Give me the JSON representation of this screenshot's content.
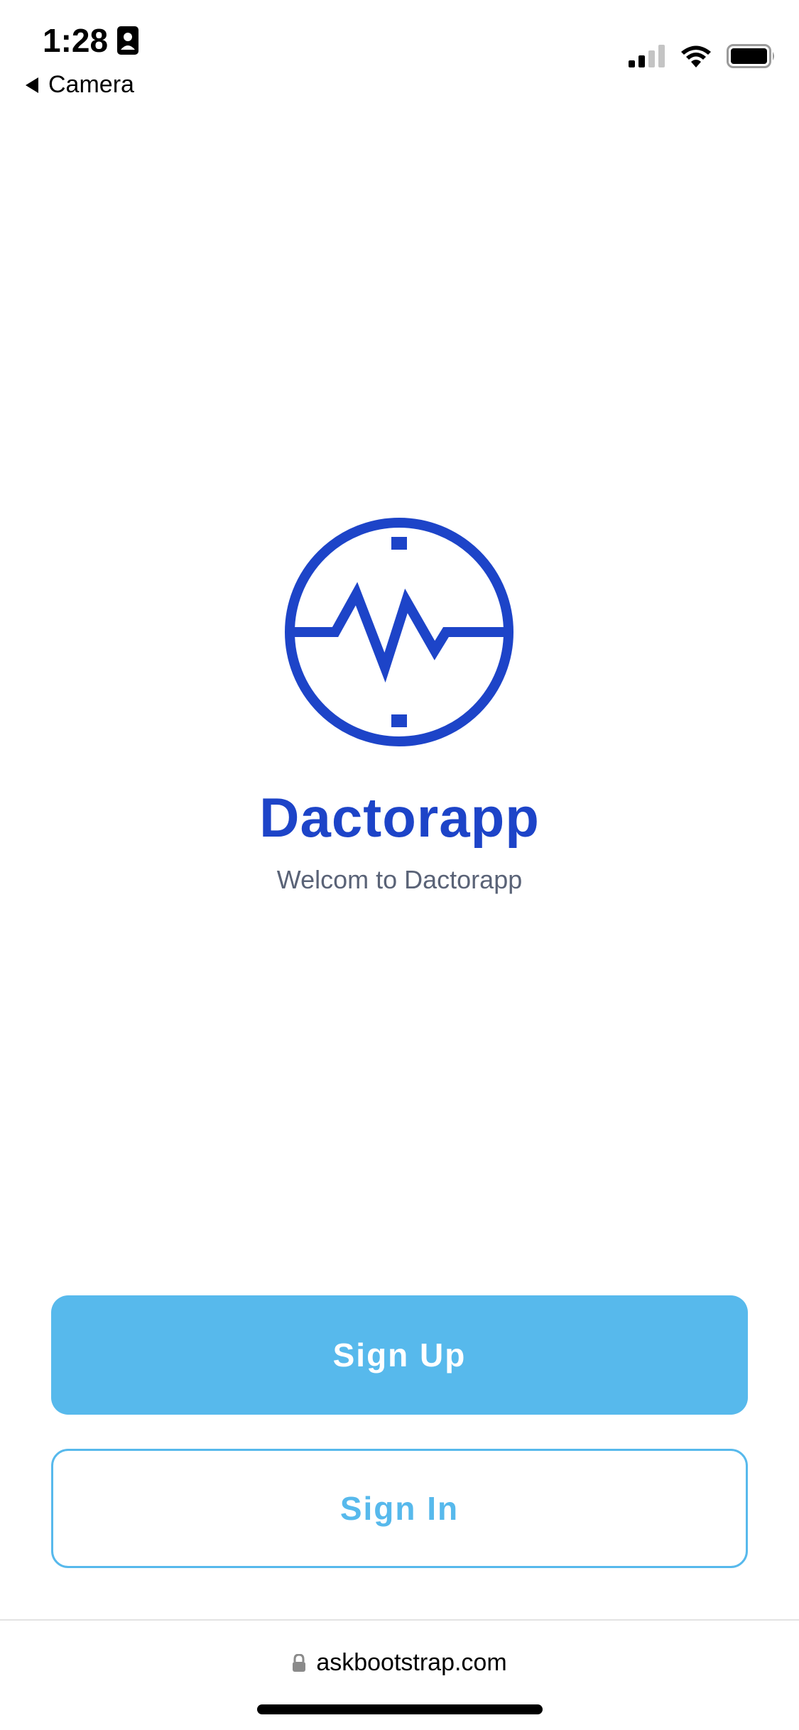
{
  "status_bar": {
    "time": "1:28",
    "back_label": "Camera"
  },
  "app": {
    "name": "Dactorapp",
    "welcome": "Welcom to Dactorapp"
  },
  "buttons": {
    "sign_up": "Sign Up",
    "sign_in": "Sign In"
  },
  "browser": {
    "url": "askbootstrap.com"
  },
  "colors": {
    "brand": "#1d44c8",
    "accent": "#57b9ec",
    "muted_text": "#5a6377"
  },
  "icons": [
    "portrait-icon",
    "signal-icon",
    "wifi-icon",
    "battery-icon",
    "heartbeat-logo-icon",
    "lock-icon"
  ]
}
